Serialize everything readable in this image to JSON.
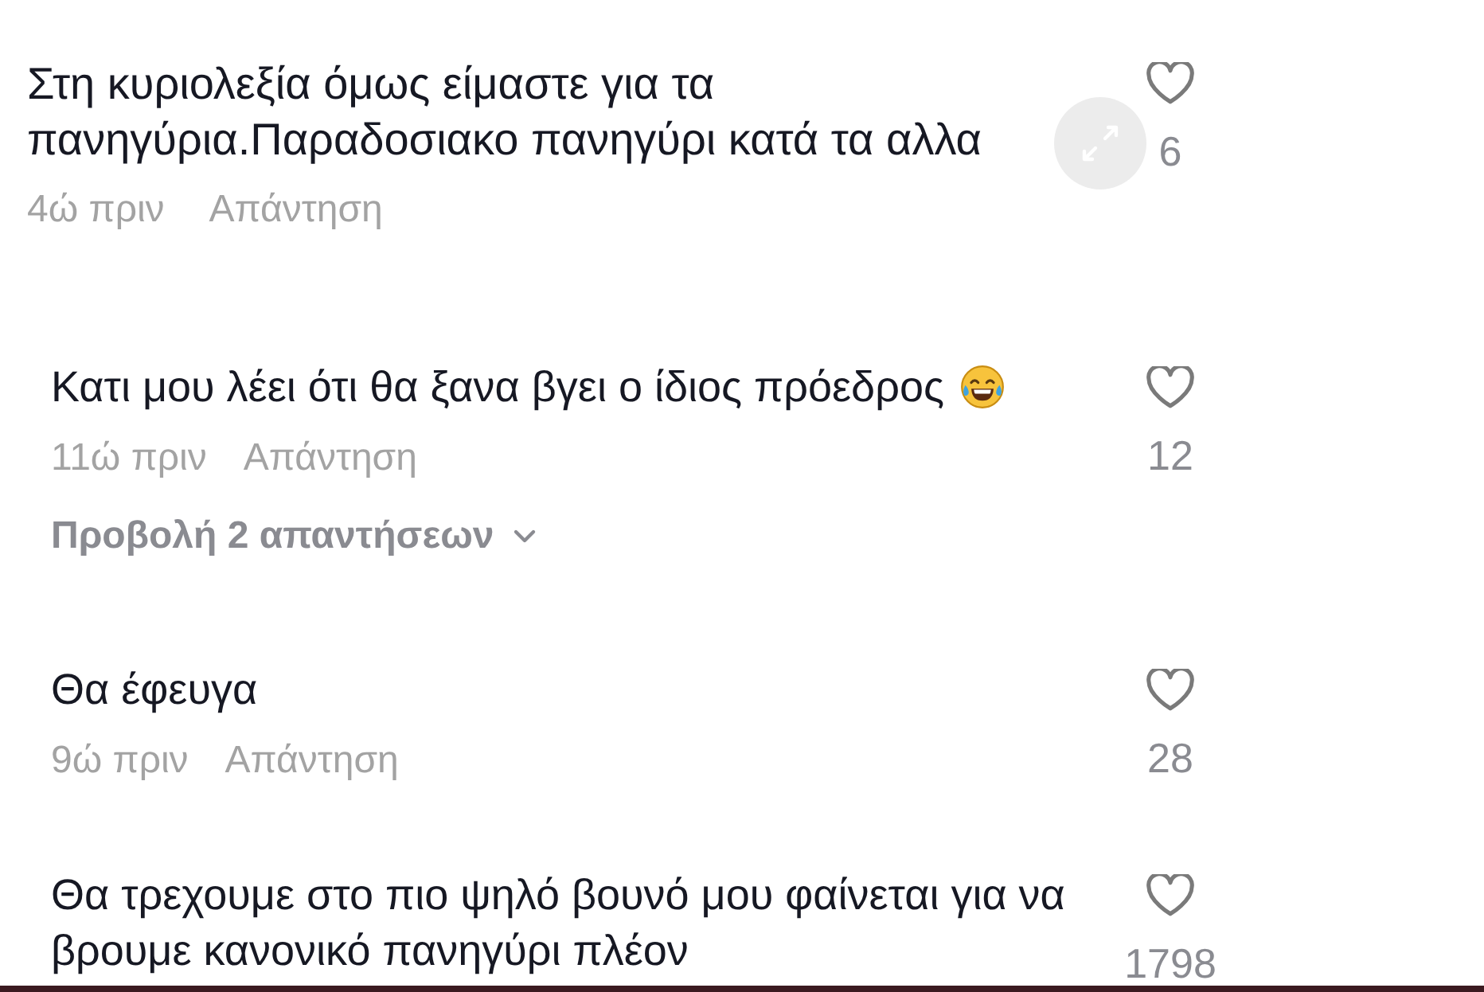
{
  "sections": [
    {
      "comments": [
        {
          "text": "Στη κυριολεξία όμως είμαστε για τα πανηγύρια.Παραδοσιακο πανηγύρι κατά τα αλλα",
          "has_emoji": false,
          "time": "4ώ πριν",
          "reply_label": "Απάντηση",
          "likes": "6",
          "liked": false
        }
      ]
    },
    {
      "comments": [
        {
          "text": "Κατι μου λέει ότι θα ξανα βγει ο ίδιος πρόεδρος",
          "has_emoji": true,
          "time": "11ώ πριν",
          "reply_label": "Απάντηση",
          "view_replies": "Προβολή 2 απαντήσεων",
          "likes": "12",
          "liked": false
        },
        {
          "text": "Θα έφευγα",
          "has_emoji": false,
          "time": "9ώ πριν",
          "reply_label": "Απάντηση",
          "likes": "28",
          "liked": false
        },
        {
          "text": "Θα τρεχουμε στο πιο ψηλό βουνό μου φαίνεται για να βρουμε κανονικό πανηγύρι πλέον",
          "has_emoji": false,
          "likes": "1798",
          "liked": false
        }
      ]
    }
  ]
}
